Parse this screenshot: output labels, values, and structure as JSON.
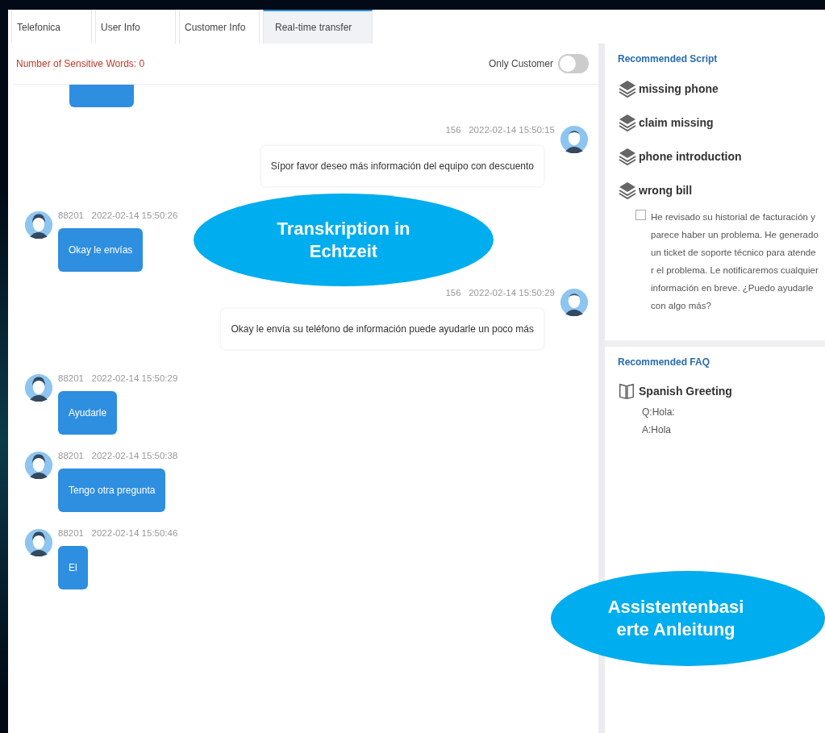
{
  "tabs": [
    {
      "label": "Telefonica",
      "selected": false
    },
    {
      "label": "User Info",
      "selected": false
    },
    {
      "label": "Customer Info",
      "selected": false
    },
    {
      "label": "Real-time transfer",
      "selected": true
    }
  ],
  "chat": {
    "sensitive_words": "Number of Sensitive Words:  0",
    "only_customer": {
      "label": "Only Customer",
      "on": false
    },
    "messages": [
      {
        "kind": "agent",
        "sender": "156",
        "time": "2022-02-14 15:50:15",
        "text": "Sípor favor deseo más información del equipo con descuento"
      },
      {
        "kind": "customer",
        "sender": "88201",
        "time": "2022-02-14 15:50:26",
        "text": "Okay le envías"
      },
      {
        "kind": "agent",
        "sender": "156",
        "time": "2022-02-14 15:50:29",
        "text": "Okay le envía su teléfono de información puede ayudarle un poco más"
      },
      {
        "kind": "customer",
        "sender": "88201",
        "time": "2022-02-14 15:50:29",
        "text": "Ayudarle"
      },
      {
        "kind": "customer",
        "sender": "88201",
        "time": "2022-02-14 15:50:38",
        "text": "Tengo otra pregunta"
      },
      {
        "kind": "customer",
        "sender": "88201",
        "time": "2022-02-14 15:50:46",
        "text": "El"
      }
    ]
  },
  "recommended_script": {
    "title": "Recommended Script",
    "items": [
      {
        "label": "missing phone"
      },
      {
        "label": "claim missing"
      },
      {
        "label": "phone introduction"
      },
      {
        "label": "wrong bill",
        "option": {
          "checked": false,
          "text": "He revisado su historial de facturación y parece haber un problema. He generado un ticket de soporte técnico para atender el problema. Le notificaremos cualquier información en breve. ¿Puedo ayudarle con algo más?"
        }
      }
    ]
  },
  "recommended_faq": {
    "title": "Recommended FAQ",
    "items": [
      {
        "title": "Spanish Greeting",
        "question": "Q:Hola:",
        "answer": "A:Hola"
      }
    ]
  },
  "callouts": [
    {
      "text": "Transkription in Echtzeit"
    },
    {
      "text": "Assistentenbasi erte Anleitung"
    }
  ]
}
